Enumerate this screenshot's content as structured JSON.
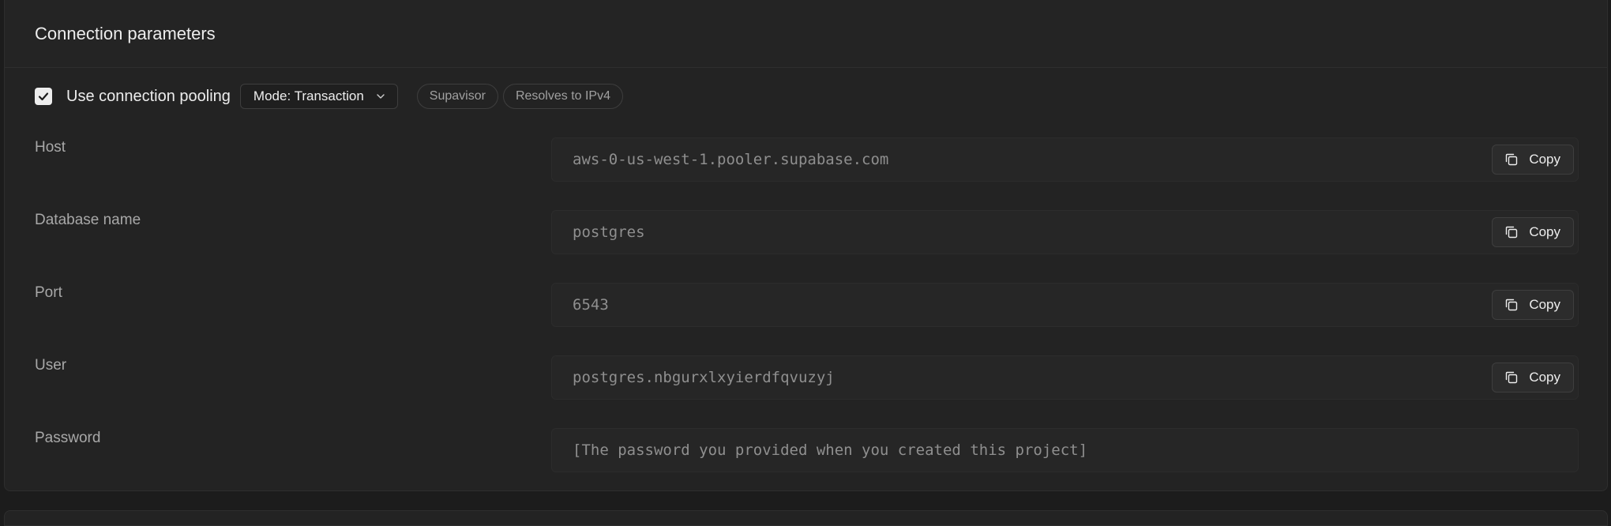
{
  "panel": {
    "title": "Connection parameters"
  },
  "toolbar": {
    "pooling_checked": true,
    "pooling_label": "Use connection pooling",
    "mode_label": "Mode: Transaction",
    "badges": [
      "Supavisor",
      "Resolves to IPv4"
    ]
  },
  "fields": [
    {
      "label": "Host",
      "value": "aws-0-us-west-1.pooler.supabase.com",
      "copy_label": "Copy"
    },
    {
      "label": "Database name",
      "value": "postgres",
      "copy_label": "Copy"
    },
    {
      "label": "Port",
      "value": "6543",
      "copy_label": "Copy"
    },
    {
      "label": "User",
      "value": "postgres.nbgurxlxyierdfqvuzyj",
      "copy_label": "Copy"
    },
    {
      "label": "Password",
      "value": "[The password you provided when you created this project]"
    }
  ],
  "icons": {
    "checkbox": "check-icon",
    "mode_select": "chevron-down-icon",
    "copy": "copy-icon"
  }
}
